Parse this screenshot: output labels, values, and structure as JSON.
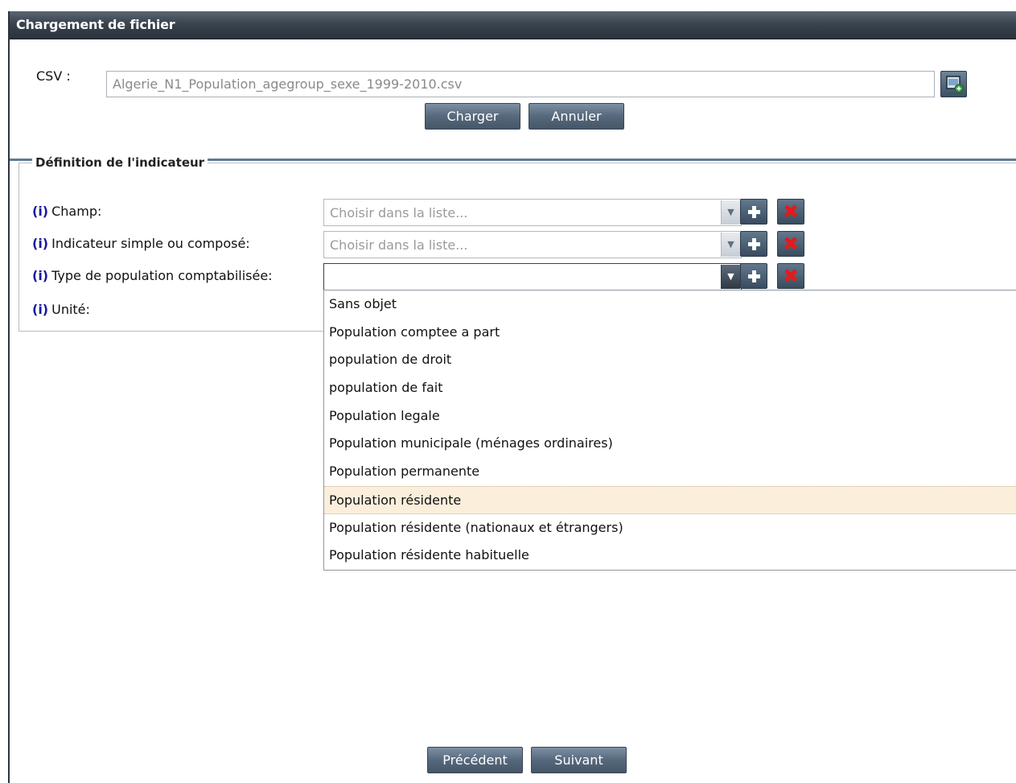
{
  "window": {
    "title": "Chargement de fichier"
  },
  "csv": {
    "label": "CSV :",
    "file_value": "Algerie_N1_Population_agegroup_sexe_1999-2010.csv",
    "load_button": "Charger",
    "cancel_button": "Annuler"
  },
  "indicator": {
    "legend": "Définition de l'indicateur",
    "info_marker": "(i)",
    "fields": [
      {
        "label": "Champ:",
        "value": "Choisir dans la liste..."
      },
      {
        "label": "Indicateur simple ou composé:",
        "value": "Choisir dans la liste..."
      },
      {
        "label": "Type de population comptabilisée:",
        "value": ""
      },
      {
        "label": "Unité:"
      }
    ]
  },
  "dropdown": {
    "options": [
      "Sans objet",
      "Population comptee a part",
      "population de droit",
      "population de fait",
      "Population legale",
      "Population municipale (ménages ordinaires)",
      "Population permanente",
      "Population résidente",
      "Population résidente (nationaux et étrangers)",
      "Population résidente habituelle"
    ],
    "highlighted": "Population résidente"
  },
  "footer": {
    "prev_button": "Précédent",
    "next_button": "Suivant"
  },
  "colors": {
    "titlebar": "#3a434e",
    "info_marker": "#1a1aa0",
    "highlight": "#fbefdc",
    "delete_icon": "#e21b1b"
  },
  "icons": {
    "file_browse": "file-browse-icon",
    "add": "plus-icon",
    "remove": "close-icon",
    "combo_arrow": "chevron-down-icon"
  }
}
